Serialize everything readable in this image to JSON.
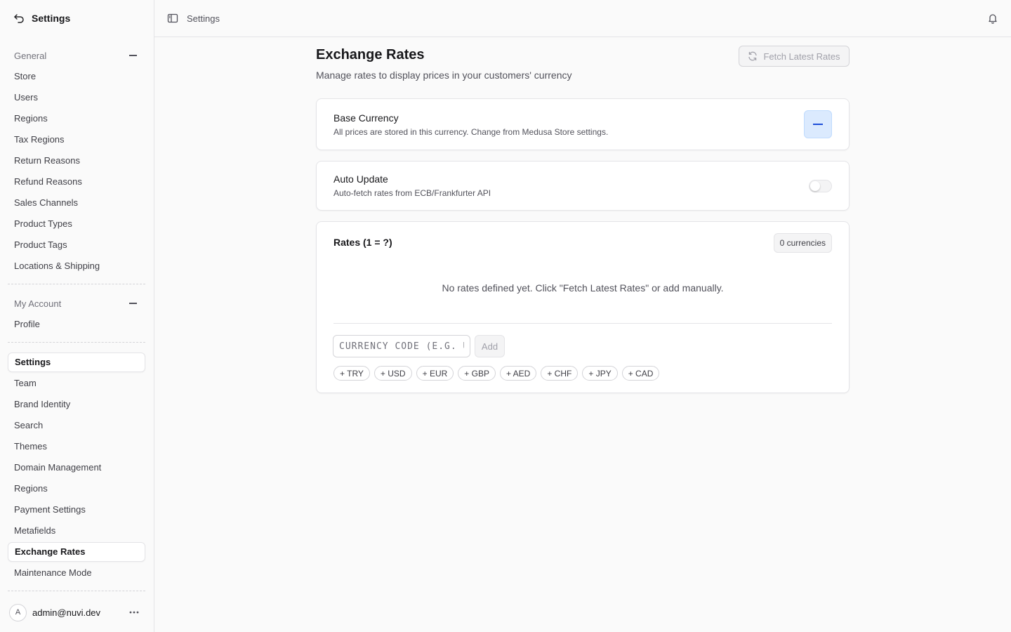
{
  "sidebar": {
    "header_title": "Settings",
    "general": {
      "title": "General",
      "items": [
        "Store",
        "Users",
        "Regions",
        "Tax Regions",
        "Return Reasons",
        "Refund Reasons",
        "Sales Channels",
        "Product Types",
        "Product Tags",
        "Locations & Shipping"
      ]
    },
    "account": {
      "title": "My Account",
      "items": [
        "Profile"
      ]
    },
    "extensions": {
      "items": [
        "Settings",
        "Team",
        "Brand Identity",
        "Search",
        "Themes",
        "Domain Management",
        "Regions",
        "Payment Settings",
        "Metafields",
        "Exchange Rates",
        "Maintenance Mode"
      ],
      "active": [
        "Settings",
        "Exchange Rates"
      ]
    },
    "user": {
      "avatar_initial": "A",
      "email": "admin@nuvi.dev"
    }
  },
  "topbar": {
    "breadcrumb": "Settings"
  },
  "page": {
    "title": "Exchange Rates",
    "subtitle": "Manage rates to display prices in your customers' currency",
    "fetch_button": "Fetch Latest Rates"
  },
  "base_currency": {
    "title": "Base Currency",
    "description": "All prices are stored in this currency. Change from Medusa Store settings.",
    "value": "—"
  },
  "auto_update": {
    "title": "Auto Update",
    "description": "Auto-fetch rates from ECB/Frankfurter API",
    "enabled": false
  },
  "rates": {
    "title": "Rates (1 = ?)",
    "count_badge": "0 currencies",
    "empty_message": "No rates defined yet. Click \"Fetch Latest Rates\" or add manually.",
    "input_placeholder": "CURRENCY CODE (E.G. USD)",
    "add_button": "Add",
    "quick_add": [
      "+ TRY",
      "+ USD",
      "+ EUR",
      "+ GBP",
      "+ AED",
      "+ CHF",
      "+ JPY",
      "+ CAD"
    ]
  },
  "colors": {
    "accent_bg": "#dbeafe",
    "accent_fg": "#1d4ed8",
    "border": "#e4e4e7",
    "background": "#fafafa"
  },
  "icons": {
    "header": "undo-arrow-icon",
    "topbar": "sidebar-toggle-icon",
    "notifications": "bell-icon",
    "fetch": "refresh-icon",
    "footer": "more-horizontal-icon"
  }
}
